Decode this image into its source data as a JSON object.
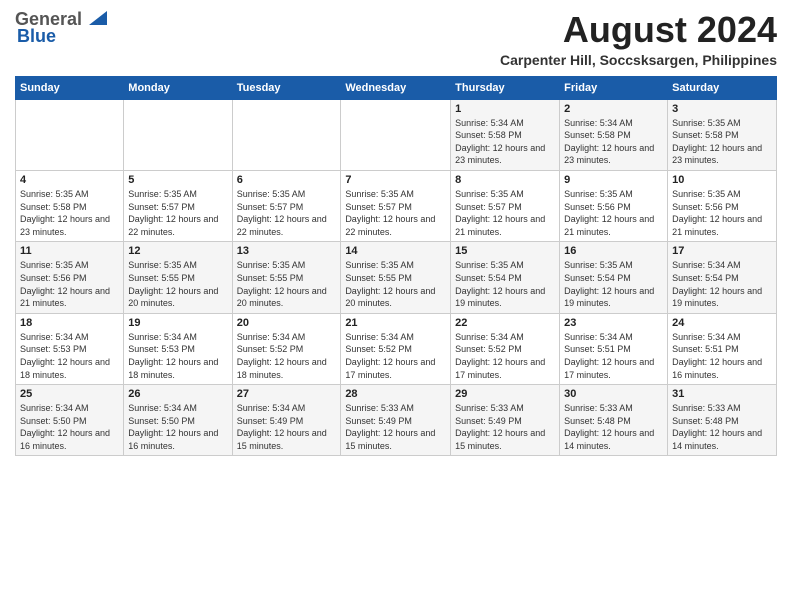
{
  "logo": {
    "general": "General",
    "blue": "Blue"
  },
  "title": "August 2024",
  "subtitle": "Carpenter Hill, Soccsksargen, Philippines",
  "days_of_week": [
    "Sunday",
    "Monday",
    "Tuesday",
    "Wednesday",
    "Thursday",
    "Friday",
    "Saturday"
  ],
  "weeks": [
    [
      {
        "day": "",
        "sunrise": "",
        "sunset": "",
        "daylight": ""
      },
      {
        "day": "",
        "sunrise": "",
        "sunset": "",
        "daylight": ""
      },
      {
        "day": "",
        "sunrise": "",
        "sunset": "",
        "daylight": ""
      },
      {
        "day": "",
        "sunrise": "",
        "sunset": "",
        "daylight": ""
      },
      {
        "day": "1",
        "sunrise": "Sunrise: 5:34 AM",
        "sunset": "Sunset: 5:58 PM",
        "daylight": "Daylight: 12 hours and 23 minutes."
      },
      {
        "day": "2",
        "sunrise": "Sunrise: 5:34 AM",
        "sunset": "Sunset: 5:58 PM",
        "daylight": "Daylight: 12 hours and 23 minutes."
      },
      {
        "day": "3",
        "sunrise": "Sunrise: 5:35 AM",
        "sunset": "Sunset: 5:58 PM",
        "daylight": "Daylight: 12 hours and 23 minutes."
      }
    ],
    [
      {
        "day": "4",
        "sunrise": "Sunrise: 5:35 AM",
        "sunset": "Sunset: 5:58 PM",
        "daylight": "Daylight: 12 hours and 23 minutes."
      },
      {
        "day": "5",
        "sunrise": "Sunrise: 5:35 AM",
        "sunset": "Sunset: 5:57 PM",
        "daylight": "Daylight: 12 hours and 22 minutes."
      },
      {
        "day": "6",
        "sunrise": "Sunrise: 5:35 AM",
        "sunset": "Sunset: 5:57 PM",
        "daylight": "Daylight: 12 hours and 22 minutes."
      },
      {
        "day": "7",
        "sunrise": "Sunrise: 5:35 AM",
        "sunset": "Sunset: 5:57 PM",
        "daylight": "Daylight: 12 hours and 22 minutes."
      },
      {
        "day": "8",
        "sunrise": "Sunrise: 5:35 AM",
        "sunset": "Sunset: 5:57 PM",
        "daylight": "Daylight: 12 hours and 21 minutes."
      },
      {
        "day": "9",
        "sunrise": "Sunrise: 5:35 AM",
        "sunset": "Sunset: 5:56 PM",
        "daylight": "Daylight: 12 hours and 21 minutes."
      },
      {
        "day": "10",
        "sunrise": "Sunrise: 5:35 AM",
        "sunset": "Sunset: 5:56 PM",
        "daylight": "Daylight: 12 hours and 21 minutes."
      }
    ],
    [
      {
        "day": "11",
        "sunrise": "Sunrise: 5:35 AM",
        "sunset": "Sunset: 5:56 PM",
        "daylight": "Daylight: 12 hours and 21 minutes."
      },
      {
        "day": "12",
        "sunrise": "Sunrise: 5:35 AM",
        "sunset": "Sunset: 5:55 PM",
        "daylight": "Daylight: 12 hours and 20 minutes."
      },
      {
        "day": "13",
        "sunrise": "Sunrise: 5:35 AM",
        "sunset": "Sunset: 5:55 PM",
        "daylight": "Daylight: 12 hours and 20 minutes."
      },
      {
        "day": "14",
        "sunrise": "Sunrise: 5:35 AM",
        "sunset": "Sunset: 5:55 PM",
        "daylight": "Daylight: 12 hours and 20 minutes."
      },
      {
        "day": "15",
        "sunrise": "Sunrise: 5:35 AM",
        "sunset": "Sunset: 5:54 PM",
        "daylight": "Daylight: 12 hours and 19 minutes."
      },
      {
        "day": "16",
        "sunrise": "Sunrise: 5:35 AM",
        "sunset": "Sunset: 5:54 PM",
        "daylight": "Daylight: 12 hours and 19 minutes."
      },
      {
        "day": "17",
        "sunrise": "Sunrise: 5:34 AM",
        "sunset": "Sunset: 5:54 PM",
        "daylight": "Daylight: 12 hours and 19 minutes."
      }
    ],
    [
      {
        "day": "18",
        "sunrise": "Sunrise: 5:34 AM",
        "sunset": "Sunset: 5:53 PM",
        "daylight": "Daylight: 12 hours and 18 minutes."
      },
      {
        "day": "19",
        "sunrise": "Sunrise: 5:34 AM",
        "sunset": "Sunset: 5:53 PM",
        "daylight": "Daylight: 12 hours and 18 minutes."
      },
      {
        "day": "20",
        "sunrise": "Sunrise: 5:34 AM",
        "sunset": "Sunset: 5:52 PM",
        "daylight": "Daylight: 12 hours and 18 minutes."
      },
      {
        "day": "21",
        "sunrise": "Sunrise: 5:34 AM",
        "sunset": "Sunset: 5:52 PM",
        "daylight": "Daylight: 12 hours and 17 minutes."
      },
      {
        "day": "22",
        "sunrise": "Sunrise: 5:34 AM",
        "sunset": "Sunset: 5:52 PM",
        "daylight": "Daylight: 12 hours and 17 minutes."
      },
      {
        "day": "23",
        "sunrise": "Sunrise: 5:34 AM",
        "sunset": "Sunset: 5:51 PM",
        "daylight": "Daylight: 12 hours and 17 minutes."
      },
      {
        "day": "24",
        "sunrise": "Sunrise: 5:34 AM",
        "sunset": "Sunset: 5:51 PM",
        "daylight": "Daylight: 12 hours and 16 minutes."
      }
    ],
    [
      {
        "day": "25",
        "sunrise": "Sunrise: 5:34 AM",
        "sunset": "Sunset: 5:50 PM",
        "daylight": "Daylight: 12 hours and 16 minutes."
      },
      {
        "day": "26",
        "sunrise": "Sunrise: 5:34 AM",
        "sunset": "Sunset: 5:50 PM",
        "daylight": "Daylight: 12 hours and 16 minutes."
      },
      {
        "day": "27",
        "sunrise": "Sunrise: 5:34 AM",
        "sunset": "Sunset: 5:49 PM",
        "daylight": "Daylight: 12 hours and 15 minutes."
      },
      {
        "day": "28",
        "sunrise": "Sunrise: 5:33 AM",
        "sunset": "Sunset: 5:49 PM",
        "daylight": "Daylight: 12 hours and 15 minutes."
      },
      {
        "day": "29",
        "sunrise": "Sunrise: 5:33 AM",
        "sunset": "Sunset: 5:49 PM",
        "daylight": "Daylight: 12 hours and 15 minutes."
      },
      {
        "day": "30",
        "sunrise": "Sunrise: 5:33 AM",
        "sunset": "Sunset: 5:48 PM",
        "daylight": "Daylight: 12 hours and 14 minutes."
      },
      {
        "day": "31",
        "sunrise": "Sunrise: 5:33 AM",
        "sunset": "Sunset: 5:48 PM",
        "daylight": "Daylight: 12 hours and 14 minutes."
      }
    ]
  ]
}
